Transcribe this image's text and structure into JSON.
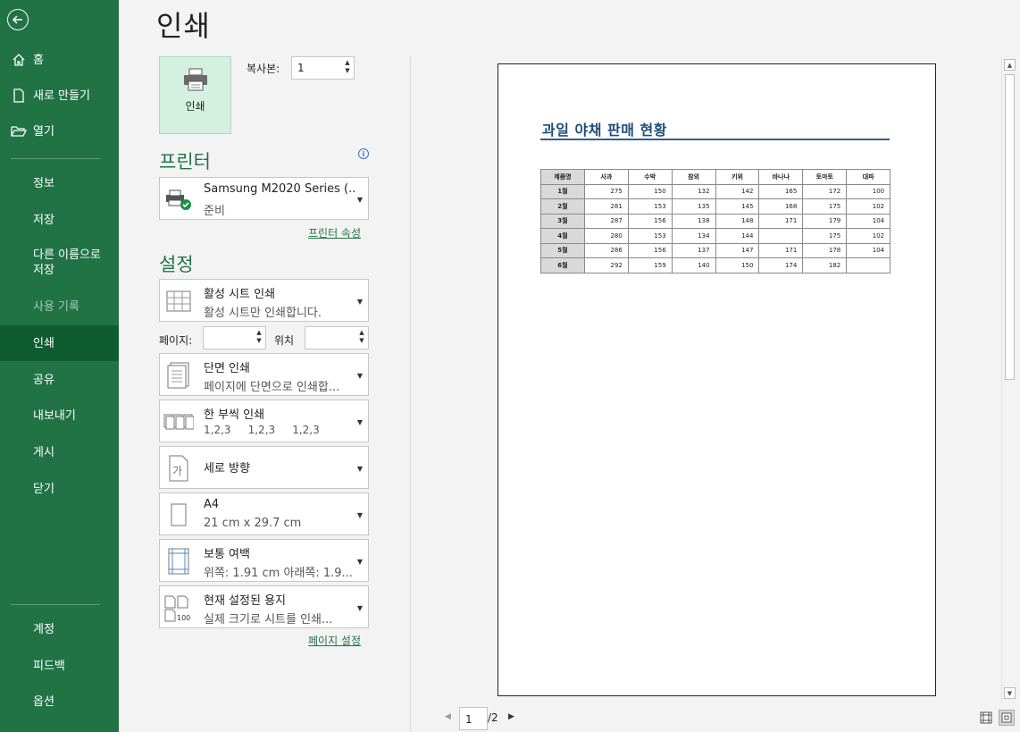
{
  "sidebar": {
    "back_icon": "back-arrow-icon",
    "items": [
      {
        "label": "홈",
        "icon": "home-icon"
      },
      {
        "label": "새로 만들기",
        "icon": "new-document-icon"
      },
      {
        "label": "열기",
        "icon": "open-folder-icon"
      },
      {
        "label": "정보"
      },
      {
        "label": "저장"
      },
      {
        "label": "다른 이름으로\n저장"
      },
      {
        "label": "사용 기록"
      },
      {
        "label": "인쇄"
      },
      {
        "label": "공유"
      },
      {
        "label": "내보내기"
      },
      {
        "label": "게시"
      },
      {
        "label": "닫기"
      },
      {
        "label": "계정"
      },
      {
        "label": "피드백"
      },
      {
        "label": "옵션"
      }
    ],
    "saveas_line1": "다른 이름으로",
    "saveas_line2": "저장",
    "accent_color": "#217346"
  },
  "main": {
    "title": "인쇄",
    "print_button_label": "인쇄",
    "copies_label": "복사본:",
    "copies_value": "1",
    "printer_section_title": "프린터",
    "printer": {
      "name": "Samsung M2020 Series (...",
      "status": "준비"
    },
    "printer_properties_link": "프린터 속성",
    "settings_section_title": "설정",
    "settings": {
      "print_what": {
        "line1": "활성 시트 인쇄",
        "line2": "활성 시트만 인쇄합니다."
      },
      "pages_label": "페이지:",
      "to_label": "위치",
      "sides": {
        "line1": "단면 인쇄",
        "line2": "페이지에 단면으로 인쇄합..."
      },
      "collate": {
        "line1": "한 부씩 인쇄",
        "line2": "1,2,3     1,2,3     1,2,3"
      },
      "orientation": {
        "line1": "세로 방향"
      },
      "paper": {
        "line1": "A4",
        "line2": "21 cm x 29.7 cm"
      },
      "margins": {
        "line1": "보통 여백",
        "line2": "위쪽: 1.91 cm 아래쪽: 1.9..."
      },
      "scaling": {
        "line1": "현재 설정된 용지",
        "line2": "실제 크기로 시트를 인쇄..."
      }
    },
    "page_setup_link": "페이지 설정"
  },
  "preview": {
    "document_title": "과일 야채 판매 현황",
    "table": {
      "headers": [
        "제품명",
        "사과",
        "수박",
        "참외",
        "키위",
        "바나나",
        "토마토",
        "대파"
      ],
      "rows": [
        [
          "1월",
          "275",
          "150",
          "132",
          "142",
          "165",
          "172",
          "100"
        ],
        [
          "2월",
          "281",
          "153",
          "135",
          "145",
          "168",
          "175",
          "102"
        ],
        [
          "3월",
          "287",
          "156",
          "138",
          "148",
          "171",
          "179",
          "104"
        ],
        [
          "4월",
          "280",
          "153",
          "134",
          "144",
          "",
          "175",
          "102"
        ],
        [
          "5월",
          "286",
          "156",
          "137",
          "147",
          "171",
          "178",
          "104"
        ],
        [
          "6월",
          "292",
          "159",
          "140",
          "150",
          "174",
          "182",
          ""
        ]
      ]
    },
    "current_page": "1",
    "total_pages": "/2"
  }
}
